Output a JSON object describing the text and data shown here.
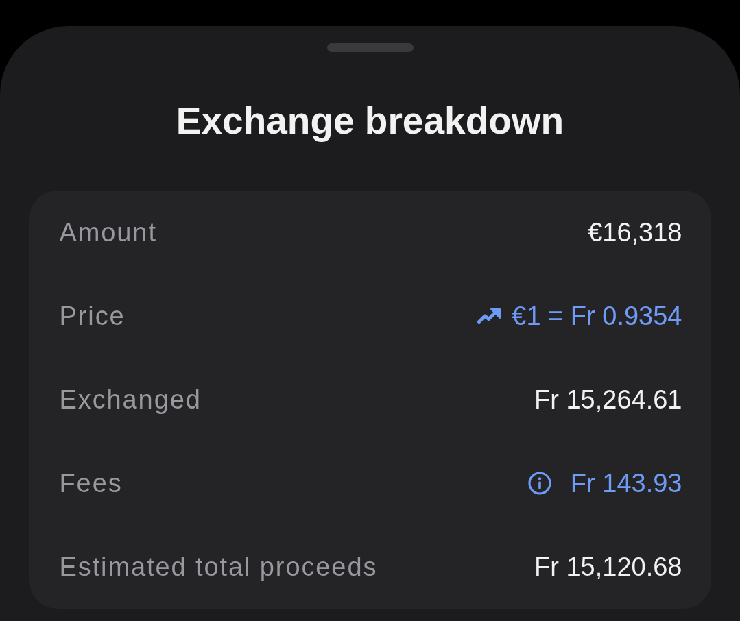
{
  "sheet": {
    "title": "Exchange breakdown"
  },
  "rows": [
    {
      "label": "Amount",
      "value": "€16,318",
      "kind": "plain"
    },
    {
      "label": "Price",
      "value": "€1 = Fr 0.9354",
      "kind": "rate"
    },
    {
      "label": "Exchanged",
      "value": "Fr 15,264.61",
      "kind": "plain"
    },
    {
      "label": "Fees",
      "value": "Fr 143.93",
      "kind": "info"
    },
    {
      "label": "Estimated total proceeds",
      "value": "Fr 15,120.68",
      "kind": "plain"
    }
  ]
}
